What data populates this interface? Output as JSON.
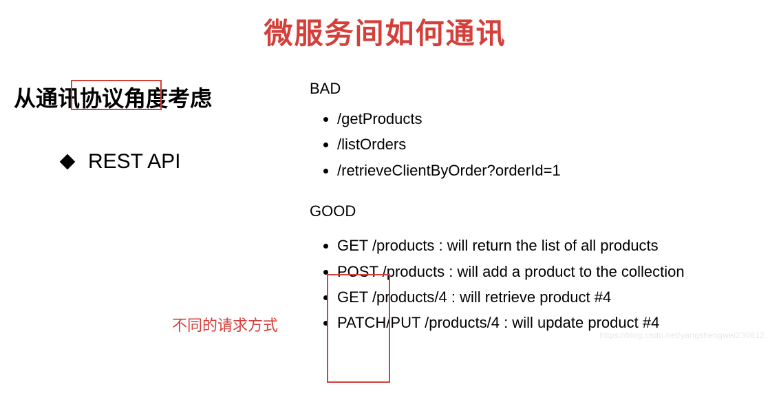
{
  "title": "微服务间如何通讯",
  "subtitle": "从通讯协议角度考虑",
  "rest": "REST API",
  "bad": {
    "label": "BAD",
    "items": [
      "/getProducts",
      "/listOrders",
      "/retrieveClientByOrder?orderId=1"
    ]
  },
  "good": {
    "label": "GOOD",
    "items": [
      "GET /products : will return the list of all products",
      "POST /products : will add a product to the collection",
      "GET /products/4 : will retrieve product #4",
      "PATCH/PUT /products/4 : will update product #4"
    ]
  },
  "annotation": "不同的请求方式",
  "watermark": "https://blog.csdn.net/yangshengwei230612"
}
